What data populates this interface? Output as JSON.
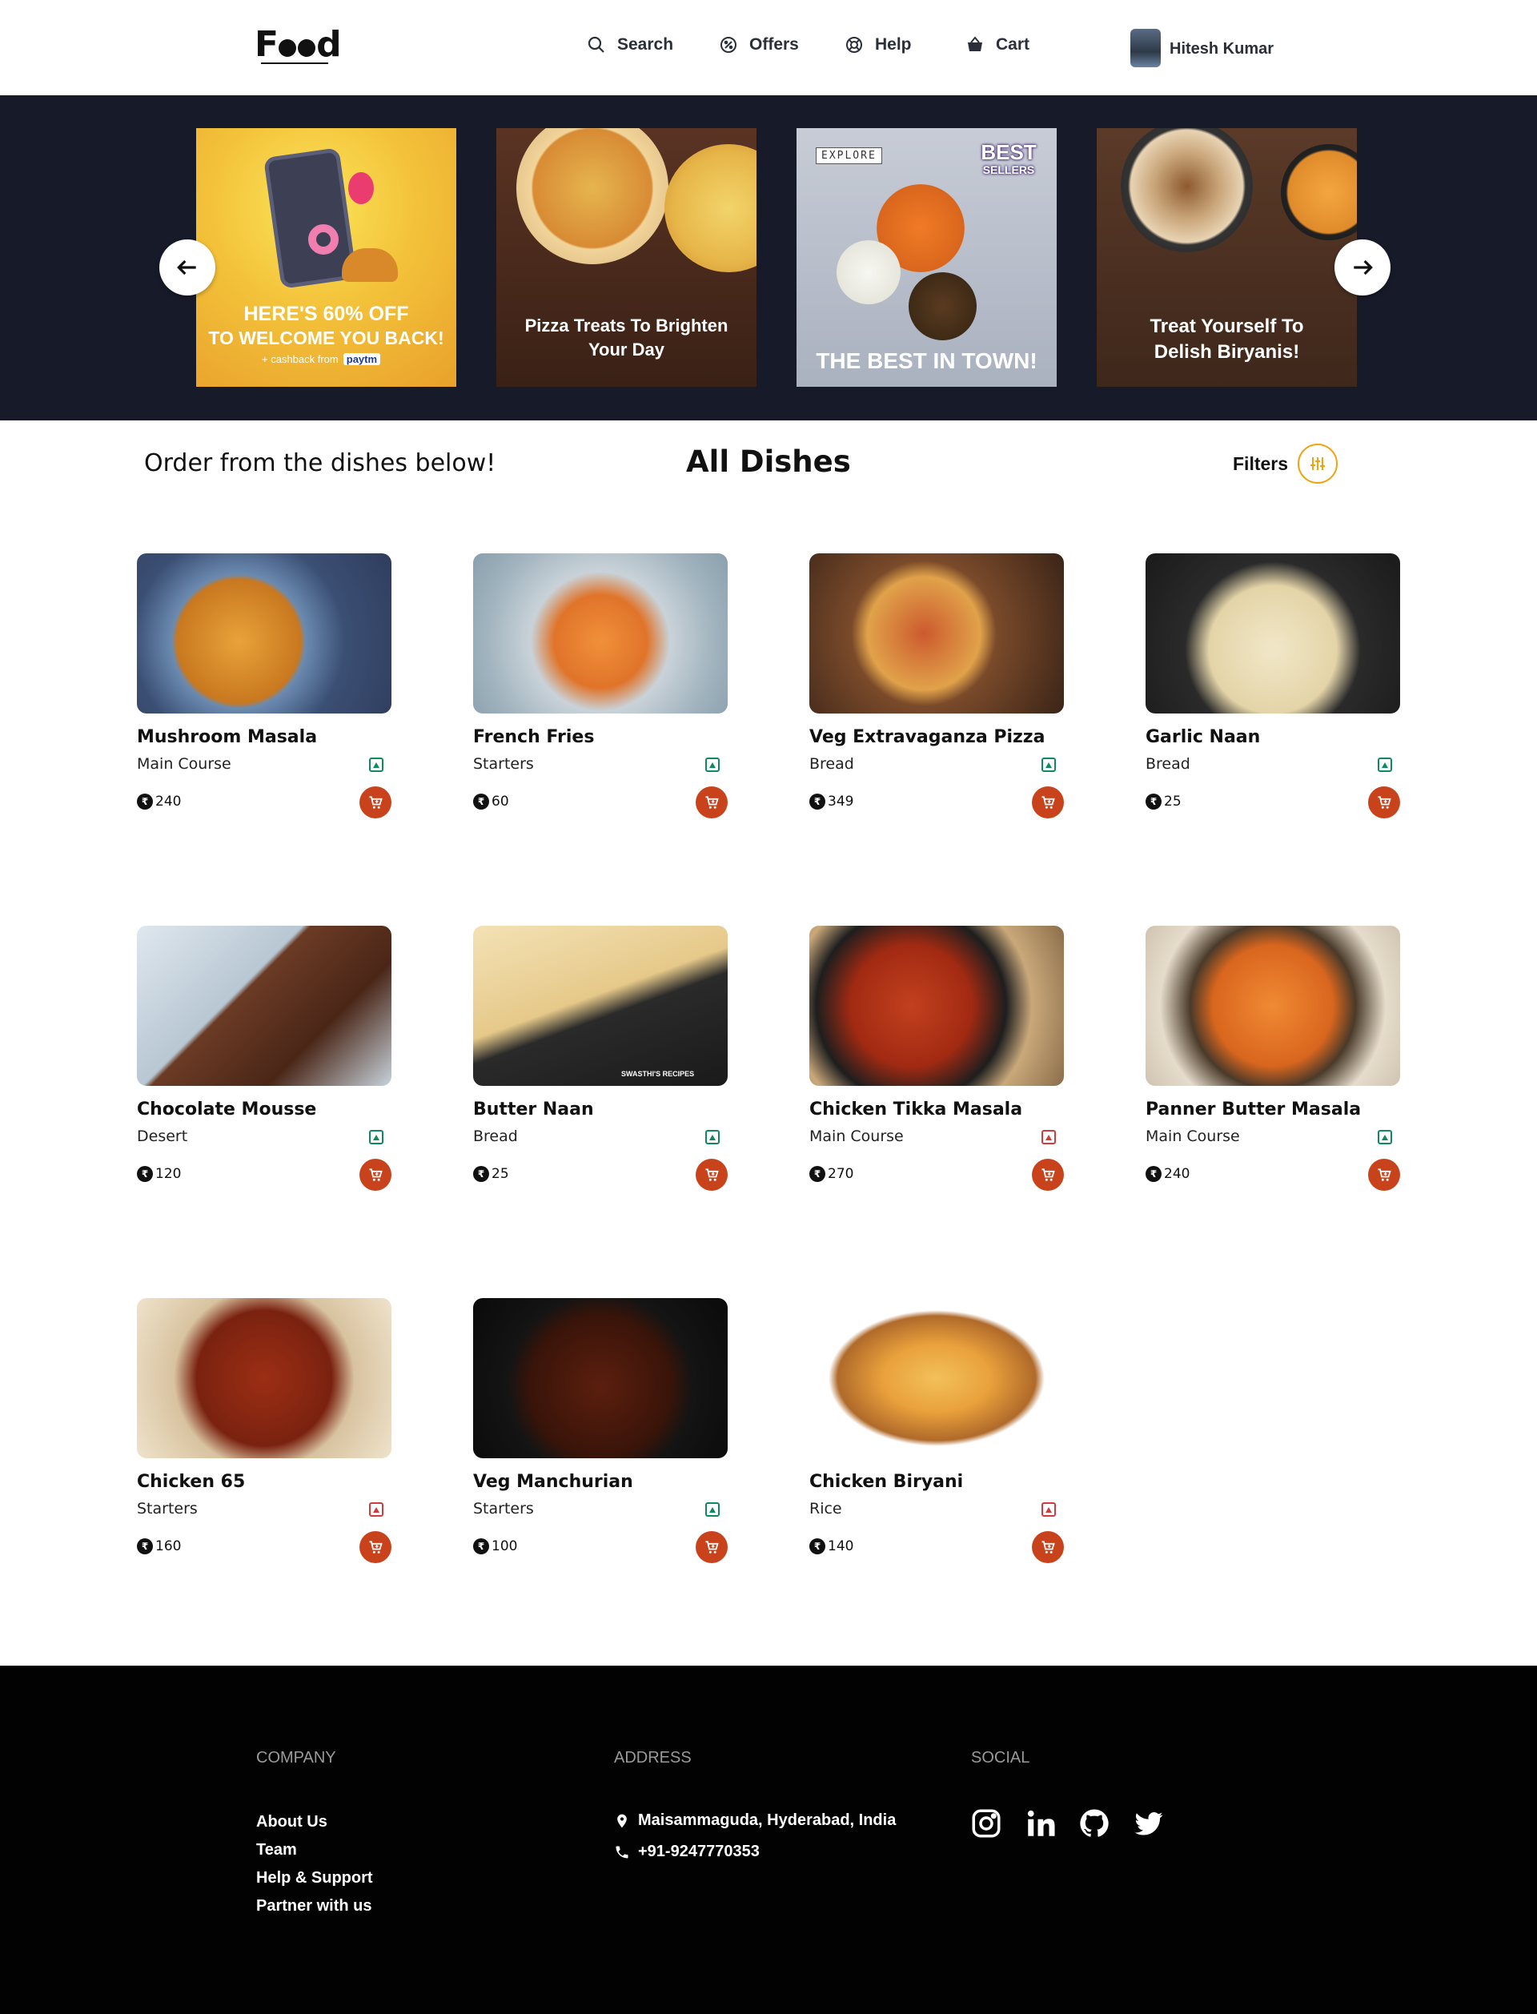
{
  "header": {
    "logo_text": "Food",
    "nav": [
      {
        "label": "Search",
        "icon": "search-icon"
      },
      {
        "label": "Offers",
        "icon": "offers-icon"
      },
      {
        "label": "Help",
        "icon": "help-icon"
      },
      {
        "label": "Cart",
        "icon": "cart-icon"
      }
    ],
    "user_name": "Hitesh Kumar"
  },
  "banner": {
    "slides": [
      {
        "line1": "HERE'S 60% OFF",
        "line2": "TO WELCOME YOU BACK!",
        "line3": "+ cashback from",
        "brand": "paytm"
      },
      {
        "line1": "Pizza Treats To Brighten",
        "line2": "Your Day"
      },
      {
        "tag": "EXPLORE",
        "badge1": "BEST",
        "badge2": "SELLERS",
        "line1": "THE BEST IN TOWN!"
      },
      {
        "line1": "Treat Yourself To",
        "line2": "Delish Biryanis!"
      }
    ]
  },
  "main": {
    "subheading": "Order from the dishes below!",
    "title": "All Dishes",
    "filters_label": "Filters"
  },
  "dishes": [
    {
      "name": "Mushroom Masala",
      "category": "Main Course",
      "price": "240",
      "veg": true
    },
    {
      "name": "French Fries",
      "category": "Starters",
      "price": "60",
      "veg": true
    },
    {
      "name": "Veg Extravaganza Pizza",
      "category": "Bread",
      "price": "349",
      "veg": true
    },
    {
      "name": "Garlic Naan",
      "category": "Bread",
      "price": "25",
      "veg": true
    },
    {
      "name": "Chocolate Mousse",
      "category": "Desert",
      "price": "120",
      "veg": true
    },
    {
      "name": "Butter Naan",
      "category": "Bread",
      "price": "25",
      "veg": true,
      "watermark": "SWASTHI'S RECIPES"
    },
    {
      "name": "Chicken Tikka Masala",
      "category": "Main Course",
      "price": "270",
      "veg": false
    },
    {
      "name": "Panner Butter Masala",
      "category": "Main Course",
      "price": "240",
      "veg": true
    },
    {
      "name": "Chicken 65",
      "category": "Starters",
      "price": "160",
      "veg": false
    },
    {
      "name": "Veg Manchurian",
      "category": "Starters",
      "price": "100",
      "veg": true
    },
    {
      "name": "Chicken Biryani",
      "category": "Rice",
      "price": "140",
      "veg": false
    }
  ],
  "footer": {
    "company_heading": "COMPANY",
    "company_links": [
      "About Us",
      "Team",
      "Help & Support",
      "Partner with us"
    ],
    "address_heading": "ADDRESS",
    "address": "Maisammaguda, Hyderabad, India",
    "phone": "+91-9247770353",
    "social_heading": "SOCIAL",
    "social": [
      "instagram-icon",
      "linkedin-icon",
      "github-icon",
      "twitter-icon"
    ]
  },
  "colors": {
    "banner_bg": "#171a29",
    "accent": "#c8431b",
    "filter_ring": "#f2a20c",
    "veg": "#0f8a5f",
    "nonveg": "#d03c3c",
    "footer_bg": "#020202"
  }
}
